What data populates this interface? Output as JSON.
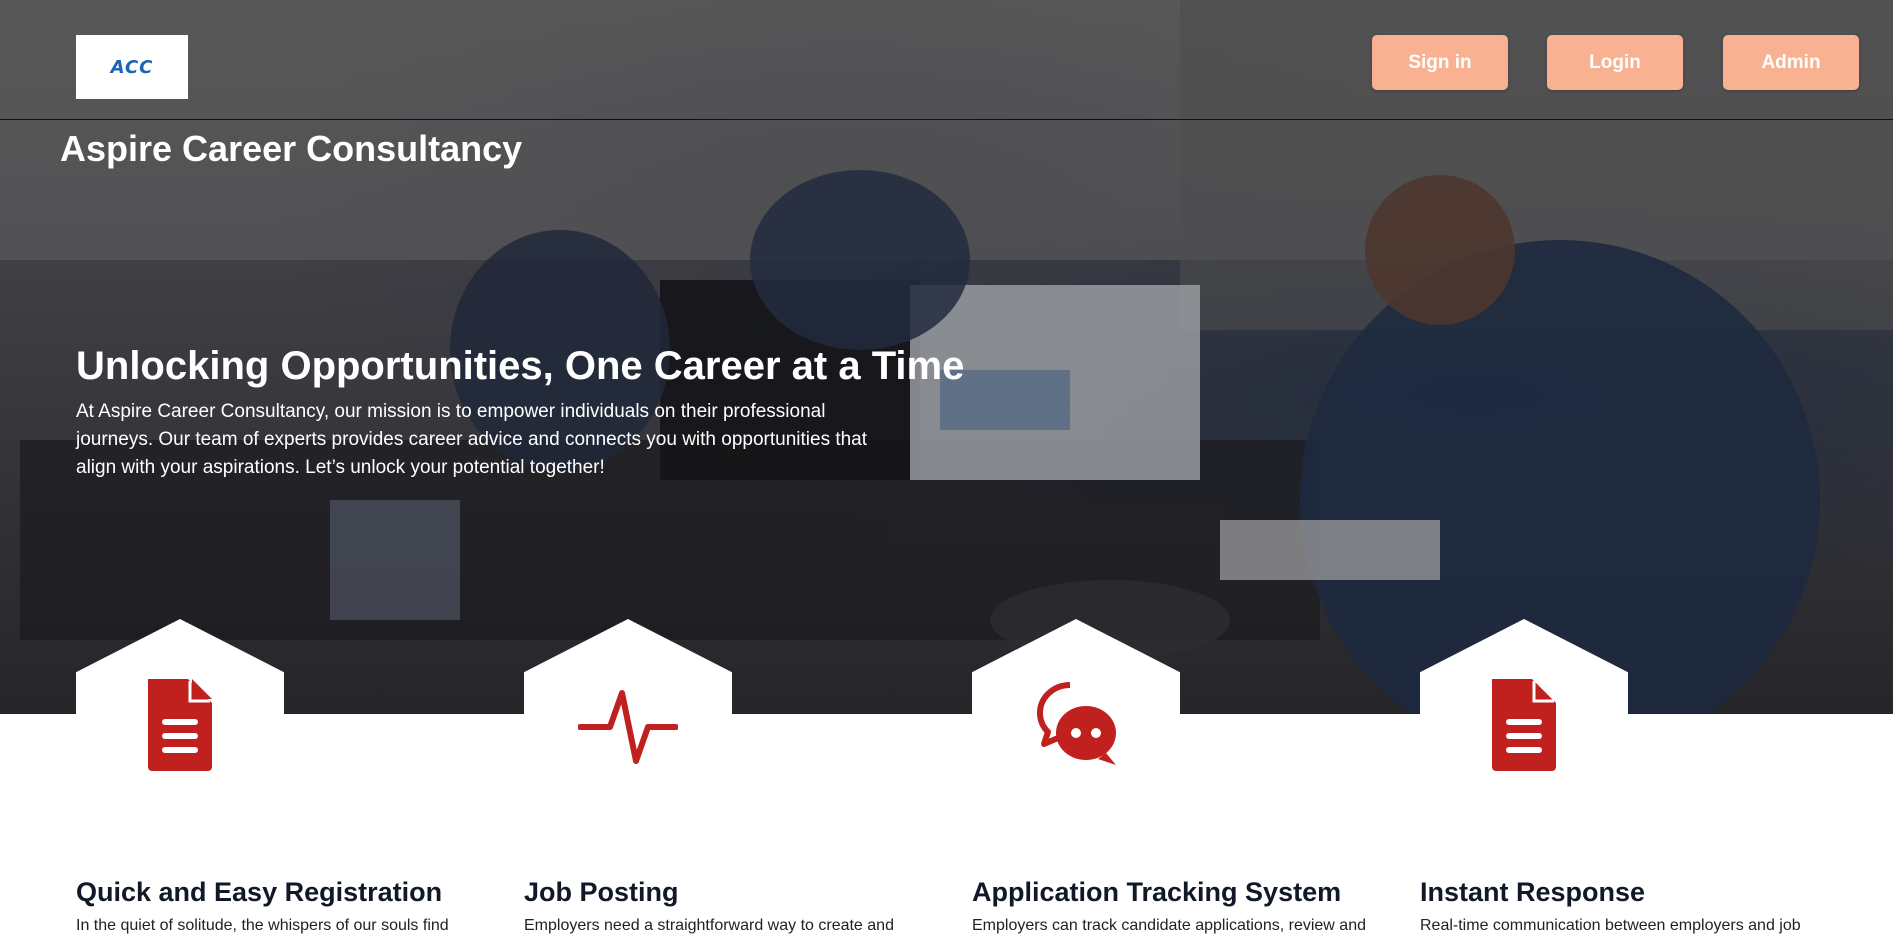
{
  "header": {
    "logo_text": "ACC",
    "brand_name": "Aspire Career Consultancy",
    "nav": {
      "sign_in": "Sign in",
      "login": "Login",
      "admin": "Admin"
    }
  },
  "hero": {
    "heading": "Unlocking Opportunities, One Career at a Time",
    "text": "At Aspire Career Consultancy, our mission is to empower individuals on their professional journeys. Our team of experts provides career advice and connects you with opportunities that align with your aspirations. Let’s unlock your potential together!"
  },
  "colors": {
    "accent_button": "#f8b292",
    "icon_red": "#c0201e",
    "logo_blue": "#1e64b4"
  },
  "features": [
    {
      "icon": "document-icon",
      "title": "Quick and Easy Registration",
      "text": "In the quiet of solitude, the whispers of our souls find"
    },
    {
      "icon": "heartbeat-icon",
      "title": "Job Posting",
      "text": "Employers need a straightforward way to create and"
    },
    {
      "icon": "chat-bubbles-icon",
      "title": "Application Tracking System",
      "text": "Employers can track candidate applications, review and"
    },
    {
      "icon": "document-icon",
      "title": "Instant Response",
      "text": "Real-time communication between employers and job"
    }
  ]
}
